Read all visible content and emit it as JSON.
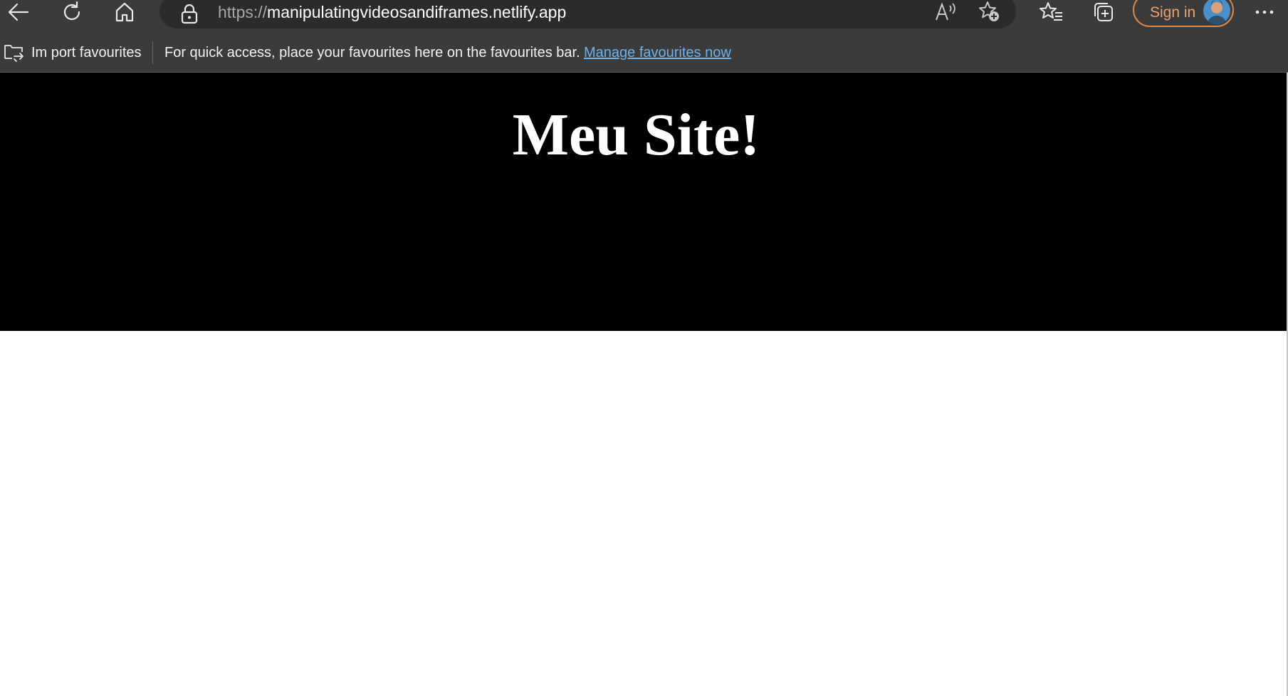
{
  "browser": {
    "url_protocol": "https://",
    "url_host": "manipulatingvideosandiframes.netlify.app",
    "sign_in_label": "Sign in",
    "icons": {
      "back": "arrow-left-icon",
      "refresh": "refresh-icon",
      "home": "home-icon",
      "site_info": "lock-icon",
      "read_aloud": "read-aloud-icon",
      "add_favourite": "star-plus-icon",
      "favourites": "favourites-icon",
      "collections": "collections-icon",
      "more": "more-icon"
    }
  },
  "favourites_bar": {
    "import_label": "Im port favourites",
    "message": "For quick access, place your favourites here on the favourites bar.",
    "manage_link": "Manage favourites now"
  },
  "page": {
    "title": "Meu Site!"
  },
  "colors": {
    "toolbar_bg": "#3b3b3b",
    "address_bg": "#2b2b2b",
    "hero_bg": "#000000",
    "link": "#6fb2ec",
    "sign_in_accent": "#d98a4a"
  }
}
